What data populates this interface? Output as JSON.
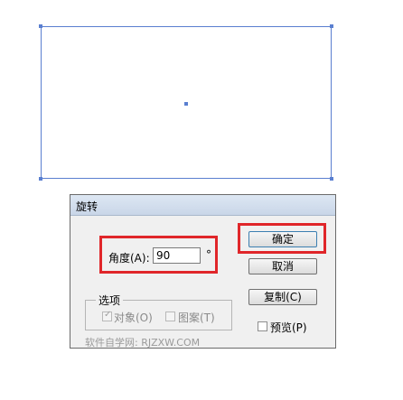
{
  "dialog": {
    "title": "旋转",
    "angle_label": "角度(A):",
    "angle_value": "90",
    "degree_symbol": "°",
    "buttons": {
      "ok": "确定",
      "cancel": "取消",
      "copy": "复制(C)"
    },
    "options_group": {
      "legend": "选项",
      "objects": {
        "label": "对象(O)",
        "checked": true,
        "enabled": false
      },
      "patterns": {
        "label": "图案(T)",
        "checked": false,
        "enabled": false
      }
    },
    "preview": {
      "label": "预览(P)",
      "checked": false
    }
  },
  "watermark": "软件自学网: RJZXW.COM",
  "colors": {
    "selection": "#5a7fd0",
    "highlight_box": "#e0262a",
    "dialog_bg": "#f0f0f0"
  }
}
